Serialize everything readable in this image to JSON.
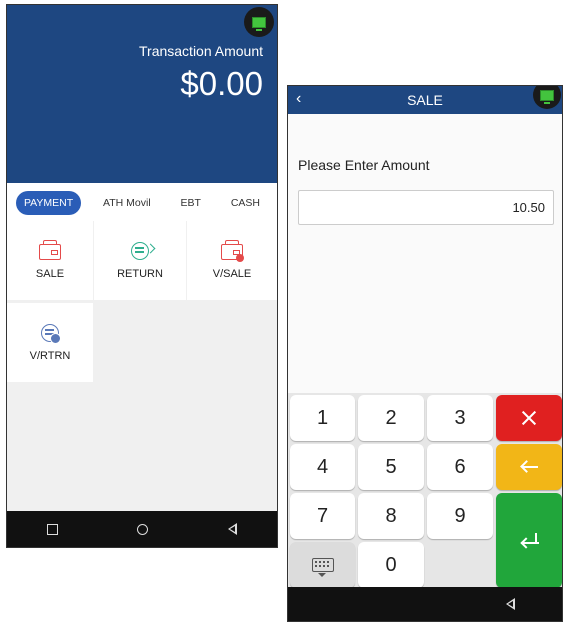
{
  "left_screen": {
    "transaction_label": "Transaction Amount",
    "transaction_amount": "$0.00",
    "tabs": [
      {
        "label": "PAYMENT",
        "active": true
      },
      {
        "label": "ATH Movil",
        "active": false
      },
      {
        "label": "EBT",
        "active": false
      },
      {
        "label": "CASH",
        "active": false
      }
    ],
    "tiles": [
      {
        "label": "SALE",
        "icon": "wallet-icon"
      },
      {
        "label": "RETURN",
        "icon": "coin-return-icon"
      },
      {
        "label": "V/SALE",
        "icon": "wallet-void-icon"
      },
      {
        "label": "V/RTRN",
        "icon": "coin-void-icon"
      }
    ]
  },
  "right_screen": {
    "title": "SALE",
    "prompt": "Please Enter Amount",
    "amount_value": "10.50",
    "keys": {
      "k1": "1",
      "k2": "2",
      "k3": "3",
      "k4": "4",
      "k5": "5",
      "k6": "6",
      "k7": "7",
      "k8": "8",
      "k9": "9",
      "k0": "0"
    },
    "function_keys": {
      "clear": "clear-icon",
      "backspace": "arrow-left-icon",
      "enter": "enter-icon",
      "keyboard": "keyboard-icon"
    }
  },
  "colors": {
    "header_blue": "#1e4781",
    "tab_active": "#2a5db7",
    "clear_red": "#e02020",
    "backspace_yellow": "#f2b617",
    "enter_green": "#21a63b",
    "status_green": "#43c43e"
  }
}
